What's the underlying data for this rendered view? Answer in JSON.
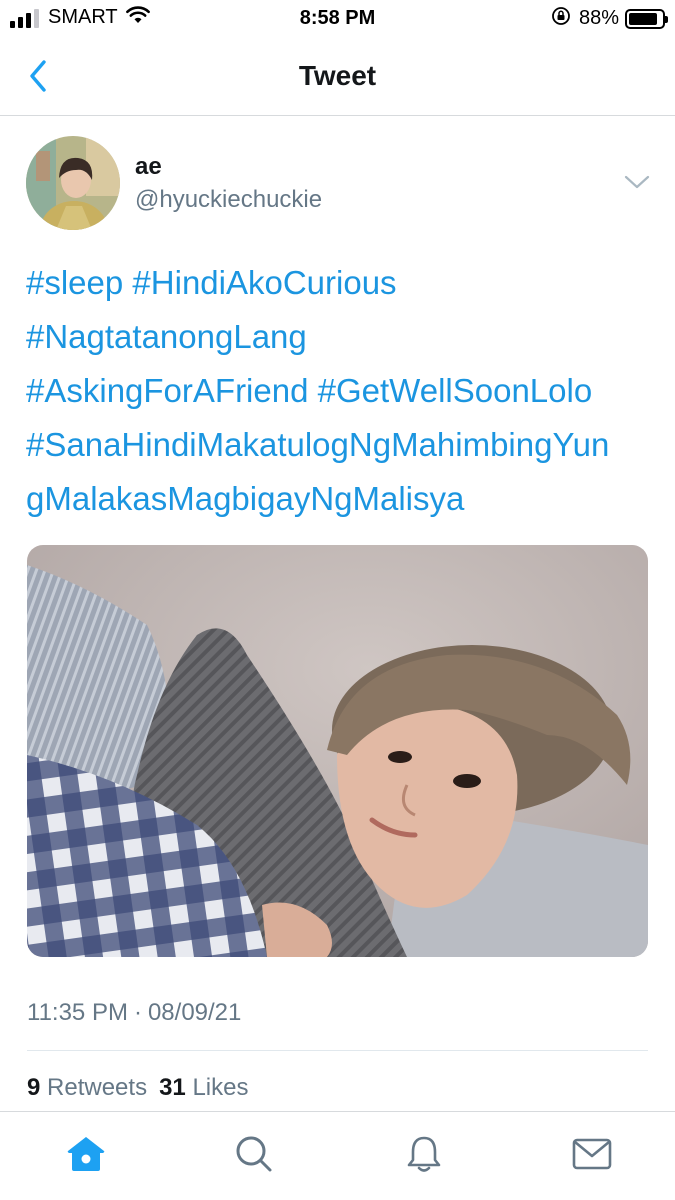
{
  "status_bar": {
    "carrier": "SMART",
    "time": "8:58 PM",
    "battery_percent_label": "88%",
    "battery_level": 0.88,
    "signal_bars_filled": 3,
    "signal_bars_total": 4
  },
  "nav": {
    "title": "Tweet",
    "back_icon": "chevron-left-icon"
  },
  "tweet": {
    "display_name": "ae",
    "handle": "@hyuckiechuckie",
    "hashtags": [
      "#sleep",
      "#HindiAkoCurious",
      "#NagtatanongLang",
      "#AskingForAFriend",
      "#GetWellSoonLolo",
      "#SanaHindiMakatulogNgMahimbingYungMalakasMagbigayNgMalisya"
    ],
    "timestamp_time": "11:35 PM",
    "timestamp_sep": "·",
    "timestamp_date": "08/09/21",
    "retweets_count": "9",
    "retweets_label": "Retweets",
    "likes_count": "31",
    "likes_label": "Likes"
  },
  "tabs": [
    {
      "name": "home",
      "icon": "home-icon",
      "active": true
    },
    {
      "name": "search",
      "icon": "search-icon",
      "active": false
    },
    {
      "name": "notifications",
      "icon": "bell-icon",
      "active": false
    },
    {
      "name": "messages",
      "icon": "mail-icon",
      "active": false
    }
  ],
  "colors": {
    "link": "#1b95e0",
    "accent": "#1da1f2",
    "secondary_text": "#657786",
    "inactive_icon": "#657786"
  }
}
